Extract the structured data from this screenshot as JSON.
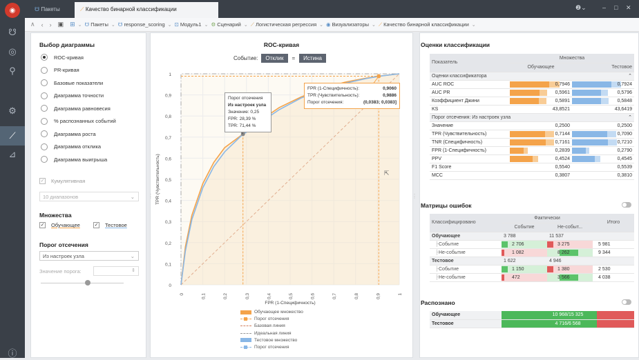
{
  "titlebar": {
    "tab1": "Пакеты",
    "tab2": "Качество бинарной классификации"
  },
  "breadcrumbs": [
    "Пакеты",
    "response_scoring",
    "Модуль1",
    "Сценарий",
    "Логистическая регрессия",
    "Визуализаторы",
    "Качество бинарной классификации"
  ],
  "left": {
    "chart_select_title": "Выбор диаграммы",
    "chart_options": [
      "ROC-кривая",
      "PR-кривая",
      "Базовые показатели",
      "Диаграмма точности",
      "Диаграмма равновесия",
      "% распознанных событий",
      "Диаграмма роста",
      "Диаграмма отклика",
      "Диаграмма выигрыша"
    ],
    "cumulative": "Кумулятивная",
    "bins": "10 диапазонов",
    "sets_title": "Множества",
    "set_train": "Обучающее",
    "set_test": "Тестовое",
    "cutoff_title": "Порог отсечения",
    "cutoff_select": "Из настроек узла",
    "threshold_label": "Значение порога:"
  },
  "chart": {
    "title": "ROC-кривая",
    "event_label": "Событие:",
    "event_field": "Отклик",
    "eq": "=",
    "event_value": "Истина",
    "ylabel": "TPR (Чувствительность)",
    "xlabel": "FPR (1-Специфичность)",
    "yticks": [
      "0",
      "0,1",
      "0,2",
      "0,3",
      "0,4",
      "0,5",
      "0,6",
      "0,7",
      "0,8",
      "0,9",
      "1"
    ],
    "xticks": [
      "0",
      "0,1",
      "0,2",
      "0,3",
      "0,4",
      "0,5",
      "0,6",
      "0,7",
      "0,8",
      "0,9",
      "1"
    ],
    "tooltip1": [
      "Порог отсечения",
      "Из настроек узла",
      "Значение: 0,25",
      "FPR: 28,39 %",
      "TPR: 71,44 %"
    ],
    "tooltip2": [
      [
        "FPR (1-Специфичность):",
        "0,9060"
      ],
      [
        "TPR (Чувствительность):",
        "0,9886"
      ],
      [
        "Порог отсечения:",
        "(0,0383; 0,0383]"
      ]
    ],
    "legend": [
      "Обучающее множество",
      "Порог отсечения",
      "Базовая линия",
      "Идеальная линия",
      "Тестовое множество",
      "Порог отсечения"
    ]
  },
  "chart_data": {
    "type": "line",
    "title": "ROC-кривая",
    "xlabel": "FPR (1-Специфичность)",
    "ylabel": "TPR (Чувствительность)",
    "xlim": [
      0,
      1
    ],
    "ylim": [
      0,
      1
    ],
    "series": [
      {
        "name": "Обучающее множество",
        "color": "#f4a34a",
        "x": [
          0,
          0.02,
          0.05,
          0.1,
          0.15,
          0.2,
          0.2839,
          0.35,
          0.45,
          0.55,
          0.65,
          0.75,
          0.85,
          0.906,
          1
        ],
        "y": [
          0,
          0.18,
          0.33,
          0.48,
          0.58,
          0.65,
          0.7144,
          0.77,
          0.84,
          0.89,
          0.93,
          0.96,
          0.98,
          0.9886,
          1
        ]
      },
      {
        "name": "Тестовое множество",
        "color": "#89b7e6",
        "x": [
          0,
          0.02,
          0.05,
          0.1,
          0.15,
          0.2,
          0.279,
          0.35,
          0.45,
          0.55,
          0.65,
          0.75,
          0.85,
          0.92,
          1
        ],
        "y": [
          0,
          0.16,
          0.31,
          0.46,
          0.56,
          0.63,
          0.709,
          0.76,
          0.83,
          0.885,
          0.925,
          0.955,
          0.978,
          0.99,
          1
        ]
      }
    ]
  },
  "metrics": {
    "title": "Оценки классификации",
    "col_indicator": "Показатель",
    "col_sets": "Множества",
    "col_train": "Обучающее",
    "col_test": "Тестовое",
    "group1": "Оценки классификатора",
    "group2": "Порог отсечения: Из настроек узла",
    "rows1": [
      {
        "name": "AUC ROC",
        "train": "0,7946",
        "test": "0,7924",
        "tv": 0.7946,
        "sv": 0.7924,
        "bar": true
      },
      {
        "name": "AUC PR",
        "train": "0,5961",
        "test": "0,5796",
        "tv": 0.5961,
        "sv": 0.5796,
        "bar": true
      },
      {
        "name": "Коэффициент Джини",
        "train": "0,5891",
        "test": "0,5848",
        "tv": 0.5891,
        "sv": 0.5848,
        "bar": true
      },
      {
        "name": "KS",
        "train": "43,8521",
        "test": "43,6419",
        "bar": false
      }
    ],
    "rows2": [
      {
        "name": "Значение",
        "train": "0,2500",
        "test": "0,2500",
        "bar": false
      },
      {
        "name": "TPR (Чувствительность)",
        "train": "0,7144",
        "test": "0,7090",
        "tv": 0.7144,
        "sv": 0.709,
        "bar": true
      },
      {
        "name": "TNR (Специфичность)",
        "train": "0,7161",
        "test": "0,7210",
        "tv": 0.7161,
        "sv": 0.721,
        "bar": true
      },
      {
        "name": "FPR (1-Специфичность)",
        "train": "0,2839",
        "test": "0,2790",
        "tv": 0.2839,
        "sv": 0.279,
        "bar": true
      },
      {
        "name": "PPV",
        "train": "0,4524",
        "test": "0,4545",
        "tv": 0.4524,
        "sv": 0.4545,
        "bar": true
      },
      {
        "name": "F1 Score",
        "train": "0,5540",
        "test": "0,5539",
        "bar": false
      },
      {
        "name": "MCC",
        "train": "0,3807",
        "test": "0,3810",
        "bar": false
      }
    ]
  },
  "matrix": {
    "title": "Матрицы ошибок",
    "col_classified": "Классифицировано",
    "col_actual": "Фактически",
    "col_event": "Событие",
    "col_nonevent": "Не-событ...",
    "col_total": "Итого",
    "rows": [
      {
        "label": "Обучающее",
        "a": "3 788",
        "b": "11 537",
        "t": "",
        "kind": "group"
      },
      {
        "label": "Событие",
        "a": "2 706",
        "b": "3 275",
        "t": "5 981",
        "kind": "ev"
      },
      {
        "label": "Не-событие",
        "a": "1 082",
        "b": "8 262",
        "t": "9 344",
        "kind": "ne"
      },
      {
        "label": "Тестовое",
        "a": "1 622",
        "b": "4 946",
        "t": "",
        "kind": "group"
      },
      {
        "label": "Событие",
        "a": "1 150",
        "b": "1 380",
        "t": "2 530",
        "kind": "ev"
      },
      {
        "label": "Не-событие",
        "a": "472",
        "b": "3 566",
        "t": "4 038",
        "kind": "ne"
      }
    ]
  },
  "recognized": {
    "title": "Распознано",
    "rows": [
      {
        "label": "Обучающее",
        "value": "10 968/15 325",
        "pct": 0.7157
      },
      {
        "label": "Тестовое",
        "value": "4 716/6 568",
        "pct": 0.718
      }
    ]
  }
}
